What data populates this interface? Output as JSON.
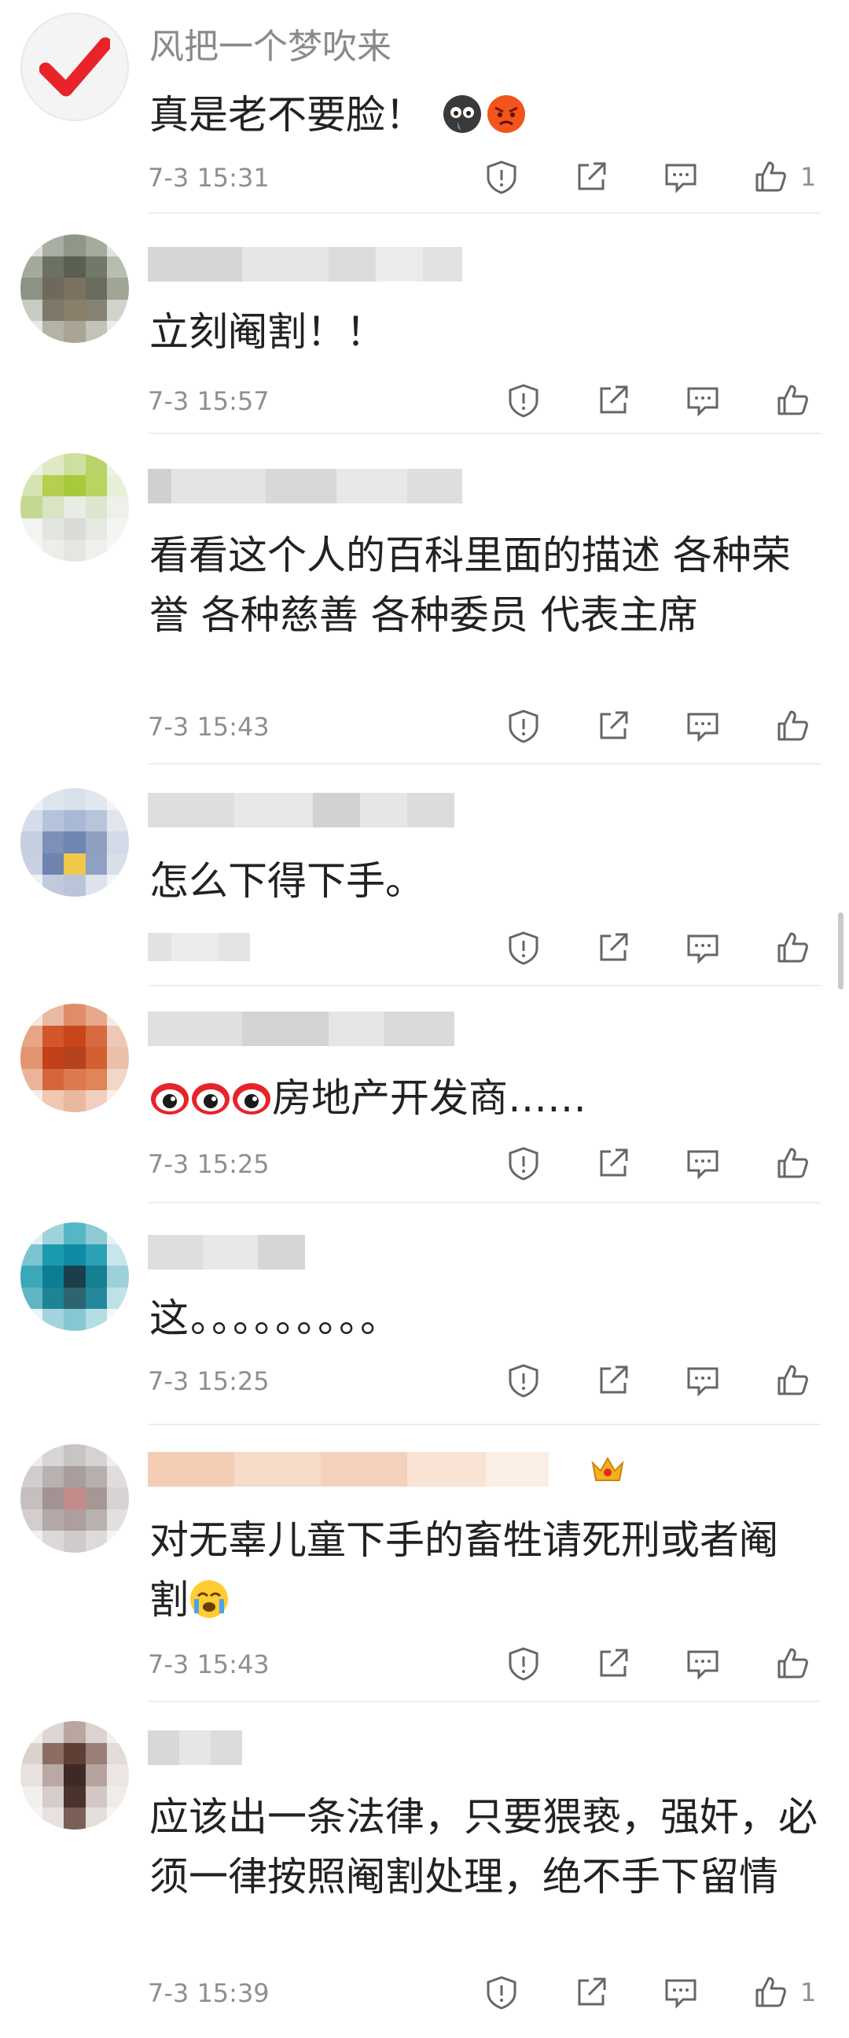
{
  "comments": [
    {
      "username": "风把一个梦吹来",
      "text": "真是老不要脸！",
      "time": "7-3 15:31",
      "like_count": "1",
      "avatar_icon": "red-checkmark-icon",
      "emojis": [
        "crying-face-icon",
        "angry-face-icon"
      ]
    },
    {
      "username": "",
      "text": "立刻阉割！！",
      "time": "7-3 15:57",
      "like_count": ""
    },
    {
      "username": "",
      "text": "看看这个人的百科里面的描述 各种荣誉 各种慈善 各种委员 代表主席",
      "time": "7-3 15:43",
      "like_count": ""
    },
    {
      "username": "",
      "text": "怎么下得下手。",
      "time": "",
      "like_count": ""
    },
    {
      "username": "",
      "text": "房地产开发商……",
      "time": "7-3 15:25",
      "like_count": "",
      "emojis": [
        "weibo-eye-icon",
        "weibo-eye-icon",
        "weibo-eye-icon"
      ]
    },
    {
      "username": "",
      "text": "这。。。。。。。。。",
      "time": "7-3 15:25",
      "like_count": ""
    },
    {
      "username": "",
      "text": "对无辜儿童下手的畜牲请死刑或者阉割",
      "time": "7-3 15:43",
      "like_count": "",
      "emojis": [
        "tearful-face-icon"
      ]
    },
    {
      "username": "",
      "text": "应该出一条法律，只要猥亵，强奸，必须一律按照阉割处理，绝不手下留情",
      "time": "7-3 15:39",
      "like_count": "1"
    }
  ],
  "action_icons": [
    "report-icon",
    "share-icon",
    "reply-icon",
    "like-icon"
  ],
  "colors": {
    "text": "#222222",
    "meta": "#8f8f8f",
    "accent_red": "#e8232a"
  }
}
